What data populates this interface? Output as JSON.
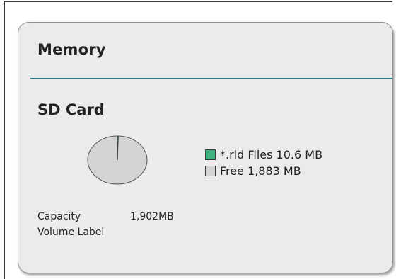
{
  "card": {
    "title": "Memory"
  },
  "sd_card": {
    "title": "SD Card",
    "legend": [
      {
        "label": "*.rld Files 10.6 MB",
        "color": "#3fb27f"
      },
      {
        "label": "Free 1,883 MB",
        "color": "#d4d4d4"
      }
    ],
    "pie_slices": [
      {
        "name": "*.rld Files",
        "value_mb": 10.6,
        "color": "#3fb27f"
      },
      {
        "name": "Free",
        "value_mb": 1883,
        "color": "#d4d4d4"
      }
    ],
    "info": [
      {
        "label": "Capacity",
        "value": "1,902MB"
      },
      {
        "label": "Volume Label",
        "value": ""
      }
    ]
  }
}
